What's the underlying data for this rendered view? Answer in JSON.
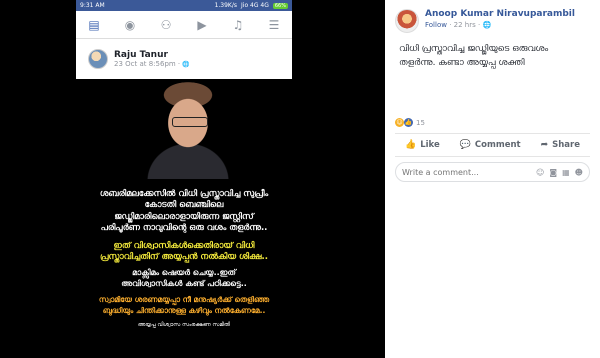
{
  "phone": {
    "status": {
      "time": "9:31 AM",
      "speed": "1.39K/s",
      "carrier": "Jio 4G 4G",
      "battery": "66%"
    },
    "nav": {
      "icons": [
        "home-icon",
        "groups-icon",
        "friends-icon",
        "watch-icon",
        "notifications-icon",
        "menu-icon"
      ]
    },
    "post": {
      "author": "Raju Tanur",
      "date": "23 Oct at 8:56pm ·",
      "caption": {
        "white_lines": [
          "ശബരിമലക്കേസിൽ വിധി പ്രസ്താവിച്ച സുപ്രീം",
          "കോടതി ബെഞ്ചിലെ",
          "ജഡ്ജിമാരിലൊരാളായിരുന്ന ജസ്റ്റിസ്",
          "പരിപൂർണ നാവുവിന്റെ ഒരു വശം തളർന്നു.."
        ],
        "yellow_lines": [
          "ഇത് വിശ്വാസികൾക്കെതിരായ് വിധി",
          "പ്രസ്താവിച്ചതിന് അയ്യപ്പൻ നൽകിയ ശിക്ഷ.."
        ],
        "white2_lines": [
          "മാക്സിമം ഷെയർ ചെയ്യ..ഇത്",
          "അവിശ്വാസികൾ കണ്ട് പഠിക്കട്ടെ.."
        ],
        "orange_lines": [
          "സ്വാമിയേ ശരണമയ്യപ്പാ നീ മനുഷ്യർക്ക് തെളിഞ്ഞ",
          "ബുദ്ധിയും ചിന്തിക്കാനുള്ള കഴിവും നൽകേണമേ.."
        ],
        "footer": "അയ്യപ്പ വിശ്വാസ സംരക്ഷണ സമിതി"
      }
    }
  },
  "panel": {
    "author": "Anoop Kumar Niravuparambil",
    "follow": "Follow",
    "time": "22 hrs",
    "text": "വിധി പ്രസ്താവിച്ച ജഡ്ജിയുടെ ഒരുവശം തളർന്നു. കണ്ടാ അയ്യപ്പ ശക്തി",
    "reaction_count": "15",
    "actions": {
      "like": "Like",
      "comment": "Comment",
      "share": "Share"
    },
    "comment_placeholder": "Write a comment..."
  }
}
